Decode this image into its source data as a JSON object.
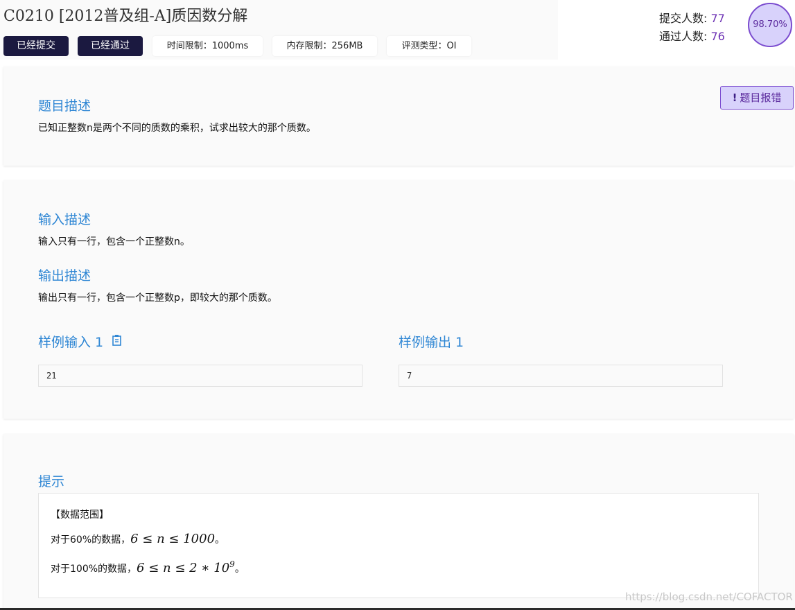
{
  "problem": {
    "title": "C0210 [2012普及组-A]质因数分解",
    "submitted_btn": "已经提交",
    "passed_btn": "已经通过",
    "time_limit": "时间限制：1000ms",
    "memory_limit": "内存限制：256MB",
    "judge_type": "评测类型：OI"
  },
  "stats": {
    "submit_label": "提交人数:",
    "submit_count": "77",
    "pass_label": "通过人数:",
    "pass_count": "76",
    "pass_rate": "98.70%"
  },
  "report": {
    "label": "题目报错",
    "icon": "exclamation-icon"
  },
  "description": {
    "heading": "题目描述",
    "text": "已知正整数n是两个不同的质数的乘积，试求出较大的那个质数。"
  },
  "io": {
    "input_heading": "输入描述",
    "input_text": "输入只有一行，包含一个正整数n。",
    "output_heading": "输出描述",
    "output_text": "输出只有一行，包含一个正整数p，即较大的那个质数。",
    "sample_input_heading": "样例输入 1",
    "sample_output_heading": "样例输出 1",
    "sample_input": "21",
    "sample_output": "7"
  },
  "hint": {
    "heading": "提示",
    "range_title": "【数据范围】",
    "line1_prefix": "对于60%的数据，",
    "line1_math": "6 ≤ n ≤ 1000",
    "line1_suffix": "。",
    "line2_prefix": "对于100%的数据，",
    "line2_math_base": "6 ≤ n ≤ 2 ∗ 10",
    "line2_math_exp": "9",
    "line2_suffix": "。"
  },
  "watermark": "https://blog.csdn.net/COFACTOR"
}
